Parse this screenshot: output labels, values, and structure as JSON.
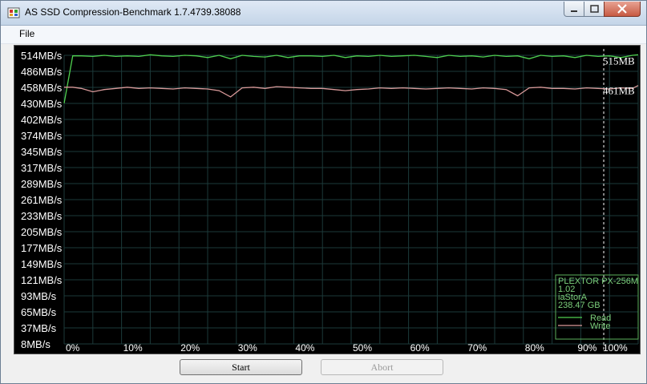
{
  "window": {
    "title": "AS SSD Compression-Benchmark 1.7.4739.38088"
  },
  "menu": {
    "file_label": "File"
  },
  "buttons": {
    "start_label": "Start",
    "abort_label": "Abort"
  },
  "drive_info": {
    "model": "PLEXTOR PX-256M",
    "firmware": "1.02",
    "driver": "iaStorA",
    "capacity": "238.47 GB"
  },
  "legend": {
    "read_label": "Read",
    "write_label": "Write"
  },
  "colors": {
    "read": "#4fd04f",
    "write": "#d99a9a",
    "grid": "#1c3a3a",
    "background": "#000000"
  },
  "chart_data": {
    "type": "line",
    "x_tick_labels": [
      "0%",
      "10%",
      "20%",
      "30%",
      "40%",
      "50%",
      "60%",
      "70%",
      "80%",
      "90%",
      "100%"
    ],
    "y_tick_labels": [
      "514MB/s",
      "486MB/s",
      "458MB/s",
      "430MB/s",
      "402MB/s",
      "374MB/s",
      "345MB/s",
      "317MB/s",
      "289MB/s",
      "261MB/s",
      "233MB/s",
      "205MB/s",
      "177MB/s",
      "149MB/s",
      "121MB/s",
      "93MB/s",
      "65MB/s",
      "37MB/s",
      "8MB/s"
    ],
    "xlim": [
      0,
      100
    ],
    "ylim": [
      8,
      514
    ],
    "grid": true,
    "legend_placement": "bottom-right",
    "marker_x": 94,
    "end_labels": {
      "read": "515MB",
      "write": "461MB"
    },
    "series": [
      {
        "name": "Read",
        "x": [
          0,
          1.5,
          3,
          5,
          7,
          9,
          11,
          13,
          15,
          17,
          19,
          21,
          23,
          25,
          27,
          29,
          31,
          33,
          35,
          37,
          39,
          41,
          43,
          45,
          47,
          49,
          51,
          53,
          55,
          57,
          59,
          61,
          63,
          65,
          67,
          69,
          71,
          73,
          75,
          77,
          79,
          81,
          83,
          85,
          87,
          89,
          91,
          93,
          95,
          97,
          99,
          100
        ],
        "values": [
          430,
          513,
          513,
          512,
          514,
          512,
          513,
          512,
          515,
          513,
          512,
          514,
          513,
          510,
          514,
          508,
          514,
          512,
          511,
          514,
          510,
          513,
          513,
          512,
          514,
          510,
          513,
          512,
          514,
          512,
          513,
          514,
          512,
          510,
          514,
          512,
          513,
          511,
          514,
          512,
          513,
          508,
          514,
          512,
          513,
          510,
          514,
          512,
          513,
          510,
          514,
          515
        ]
      },
      {
        "name": "Write",
        "x": [
          0,
          1.5,
          3,
          5,
          7,
          9,
          11,
          13,
          15,
          17,
          19,
          21,
          23,
          25,
          27,
          29,
          31,
          33,
          35,
          37,
          39,
          41,
          43,
          45,
          47,
          49,
          51,
          53,
          55,
          57,
          59,
          61,
          63,
          65,
          67,
          69,
          71,
          73,
          75,
          77,
          79,
          81,
          83,
          85,
          87,
          89,
          91,
          93,
          95,
          97,
          99,
          100
        ],
        "values": [
          458,
          458,
          456,
          450,
          454,
          456,
          458,
          456,
          457,
          456,
          455,
          457,
          456,
          455,
          452,
          441,
          457,
          458,
          456,
          459,
          458,
          457,
          456,
          456,
          454,
          452,
          454,
          455,
          457,
          456,
          457,
          456,
          455,
          456,
          457,
          456,
          455,
          457,
          456,
          454,
          443,
          457,
          458,
          456,
          456,
          455,
          457,
          456,
          455,
          457,
          456,
          461
        ]
      }
    ]
  }
}
